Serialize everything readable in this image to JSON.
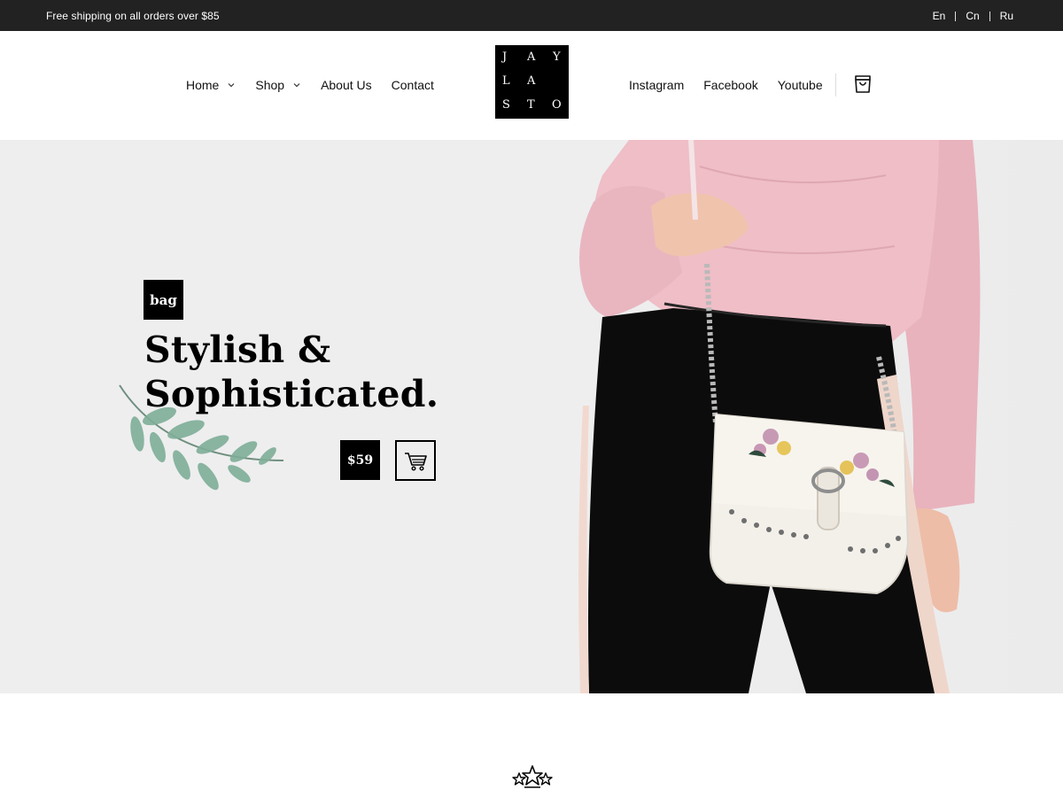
{
  "topbar": {
    "shipping_text": "Free shipping on all orders over $85",
    "languages": [
      "En",
      "Cn",
      "Ru"
    ]
  },
  "header": {
    "logo_letters": [
      "J",
      "A",
      "Y",
      "L",
      "A",
      "S",
      "T",
      "O"
    ],
    "nav_left": [
      {
        "label": "Home",
        "has_dropdown": true
      },
      {
        "label": "Shop",
        "has_dropdown": true
      },
      {
        "label": "About Us",
        "has_dropdown": false
      },
      {
        "label": "Contact",
        "has_dropdown": false
      }
    ],
    "nav_right": [
      "Instagram",
      "Facebook",
      "Youtube"
    ],
    "cart_icon": "shopping-bag-icon"
  },
  "hero": {
    "tag": "bag",
    "headline_line1": "Stylish &",
    "headline_line2": "Sophisticated.",
    "price": "$59",
    "add_to_cart_icon": "cart-icon",
    "background_color": "#eeeeef",
    "accent_color": "#000000"
  },
  "footer_section": {
    "icon": "stars-icon"
  }
}
